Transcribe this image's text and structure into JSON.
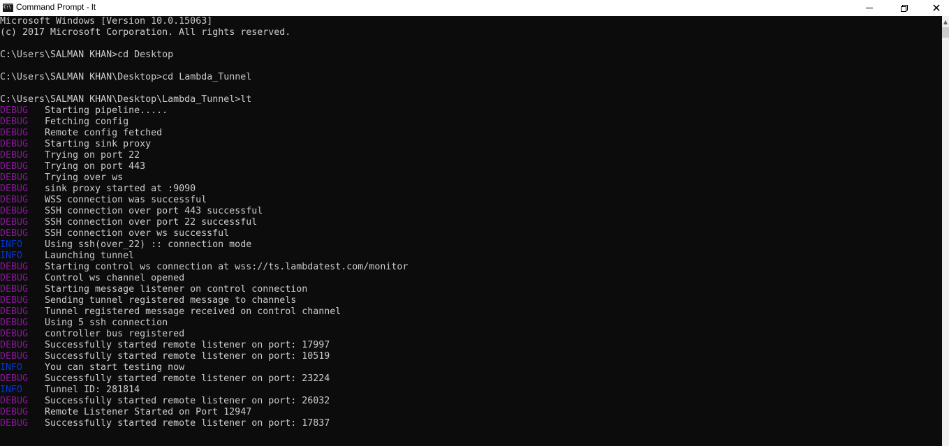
{
  "window": {
    "title": "Command Prompt - lt",
    "controls": {
      "minimize": "minimize",
      "maximize": "restore",
      "close": "close"
    }
  },
  "colors": {
    "debug": "#881798",
    "info": "#0037da",
    "text": "#cccccc",
    "background": "#0c0c0c"
  },
  "console": {
    "header": [
      "Microsoft Windows [Version 10.0.15063]",
      "(c) 2017 Microsoft Corporation. All rights reserved."
    ],
    "commands": [
      {
        "prompt": "C:\\Users\\SALMAN KHAN>",
        "command": "cd Desktop"
      },
      {
        "prompt": "C:\\Users\\SALMAN KHAN\\Desktop>",
        "command": "cd Lambda_Tunnel"
      },
      {
        "prompt": "C:\\Users\\SALMAN KHAN\\Desktop\\Lambda_Tunnel>",
        "command": "lt"
      }
    ],
    "log": [
      {
        "level": "DEBUG",
        "message": "Starting pipeline....."
      },
      {
        "level": "DEBUG",
        "message": "Fetching config"
      },
      {
        "level": "DEBUG",
        "message": "Remote config fetched"
      },
      {
        "level": "DEBUG",
        "message": "Starting sink proxy"
      },
      {
        "level": "DEBUG",
        "message": "Trying on port 22"
      },
      {
        "level": "DEBUG",
        "message": "Trying on port 443"
      },
      {
        "level": "DEBUG",
        "message": "Trying over ws"
      },
      {
        "level": "DEBUG",
        "message": "sink proxy started at :9090"
      },
      {
        "level": "DEBUG",
        "message": "WSS connection was successful"
      },
      {
        "level": "DEBUG",
        "message": "SSH connection over port 443 successful"
      },
      {
        "level": "DEBUG",
        "message": "SSH connection over port 22 successful"
      },
      {
        "level": "DEBUG",
        "message": "SSH connection over ws successful"
      },
      {
        "level": "INFO",
        "message": "Using ssh(over_22) :: connection mode"
      },
      {
        "level": "INFO",
        "message": "Launching tunnel"
      },
      {
        "level": "DEBUG",
        "message": "Starting control ws connection at wss://ts.lambdatest.com/monitor"
      },
      {
        "level": "DEBUG",
        "message": "Control ws channel opened"
      },
      {
        "level": "DEBUG",
        "message": "Starting message listener on control connection"
      },
      {
        "level": "DEBUG",
        "message": "Sending tunnel registered message to channels"
      },
      {
        "level": "DEBUG",
        "message": "Tunnel registered message received on control channel"
      },
      {
        "level": "DEBUG",
        "message": "Using 5 ssh connection"
      },
      {
        "level": "DEBUG",
        "message": "controller bus registered"
      },
      {
        "level": "DEBUG",
        "message": "Successfully started remote listener on port: 17997"
      },
      {
        "level": "DEBUG",
        "message": "Successfully started remote listener on port: 10519"
      },
      {
        "level": "INFO",
        "message": "You can start testing now"
      },
      {
        "level": "DEBUG",
        "message": "Successfully started remote listener on port: 23224"
      },
      {
        "level": "INFO",
        "message": "Tunnel ID: 281814"
      },
      {
        "level": "DEBUG",
        "message": "Successfully started remote listener on port: 26032"
      },
      {
        "level": "DEBUG",
        "message": "Remote Listener Started on Port 12947"
      },
      {
        "level": "DEBUG",
        "message": "Successfully started remote listener on port: 17837"
      }
    ]
  },
  "scrollbar": {
    "up_arrow": "▲"
  }
}
